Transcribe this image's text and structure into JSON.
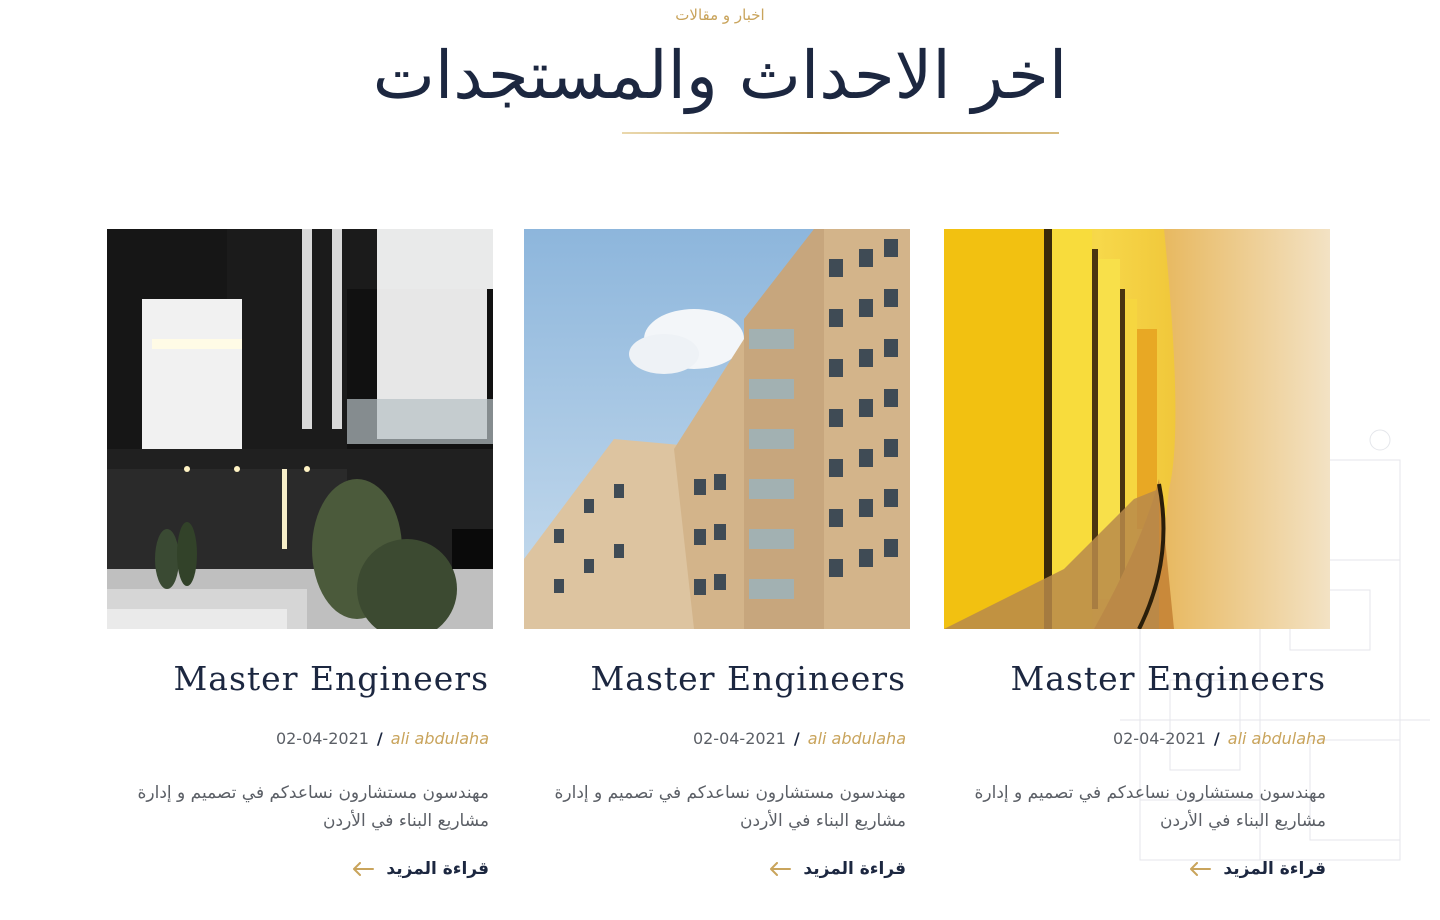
{
  "section": {
    "eyebrow": "اخبار و مقالات",
    "title": "اخر الاحداث والمستجدات"
  },
  "colors": {
    "accent_gold": "#c9a45c",
    "navy": "#1c2740",
    "body_text": "#5b5f66"
  },
  "cards": [
    {
      "image": "modern-black-white-villa-photo",
      "title": "Master Engineers",
      "date": "02-04-2021",
      "separator": "/",
      "author": "ali abdulaha",
      "description": "مهندسون مستشارون نساعدكم في تصميم و إدارة مشاريع البناء في الأردن",
      "read_more": "قراءة المزيد",
      "read_more_icon": "arrow-left-icon"
    },
    {
      "image": "beige-apartment-building-photo",
      "title": "Master Engineers",
      "date": "02-04-2021",
      "separator": "/",
      "author": "ali abdulaha",
      "description": "مهندسون مستشارون نساعدكم في تصميم و إدارة مشاريع البناء في الأردن",
      "read_more": "قراءة المزيد",
      "read_more_icon": "arrow-left-icon"
    },
    {
      "image": "yellow-illuminated-corridor-photo",
      "title": "Master Engineers",
      "date": "02-04-2021",
      "separator": "/",
      "author": "ali abdulaha",
      "description": "مهندسون مستشارون نساعدكم في تصميم و إدارة مشاريع البناء في الأردن",
      "read_more": "قراءة المزيد",
      "read_more_icon": "arrow-left-icon"
    }
  ]
}
